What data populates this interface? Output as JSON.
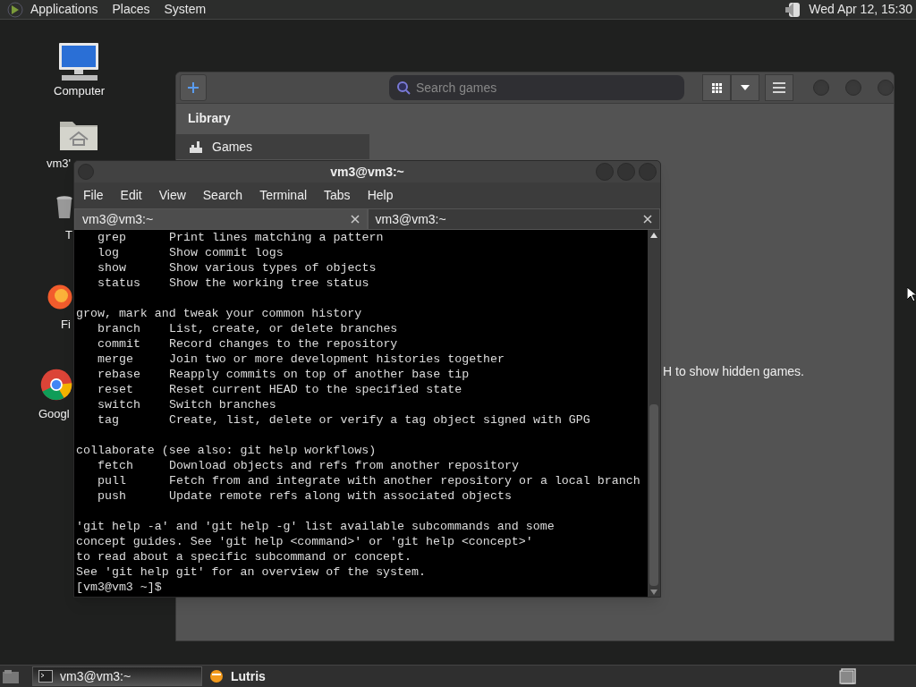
{
  "top_panel": {
    "menus": [
      "Applications",
      "Places",
      "System"
    ],
    "clock": "Wed Apr 12, 15:30"
  },
  "desktop_icons": [
    {
      "kind": "computer",
      "label": "Computer"
    },
    {
      "kind": "home",
      "label": "vm3'"
    },
    {
      "kind": "trash",
      "label": "T"
    },
    {
      "kind": "firefox",
      "label": "Fi"
    },
    {
      "kind": "chrome",
      "label": "Googl"
    }
  ],
  "lutris": {
    "search": {
      "placeholder": "Search games"
    },
    "sidebar": {
      "heading": "Library",
      "items": [
        {
          "label": "Games",
          "selected": true
        }
      ]
    },
    "hint": "H to show hidden games."
  },
  "terminal": {
    "title": "vm3@vm3:~",
    "menus": [
      "File",
      "Edit",
      "View",
      "Search",
      "Terminal",
      "Tabs",
      "Help"
    ],
    "tabs": [
      {
        "label": "vm3@vm3:~",
        "selected": false
      },
      {
        "label": "vm3@vm3:~",
        "selected": true
      }
    ],
    "blocks": [
      {
        "rows": [
          {
            "command": "grep",
            "description": "Print lines matching a pattern"
          },
          {
            "command": "log",
            "description": "Show commit logs"
          },
          {
            "command": "show",
            "description": "Show various types of objects"
          },
          {
            "command": "status",
            "description": "Show the working tree status"
          }
        ]
      },
      {
        "heading": "grow, mark and tweak your common history",
        "rows": [
          {
            "command": "branch",
            "description": "List, create, or delete branches"
          },
          {
            "command": "commit",
            "description": "Record changes to the repository"
          },
          {
            "command": "merge",
            "description": "Join two or more development histories together"
          },
          {
            "command": "rebase",
            "description": "Reapply commits on top of another base tip"
          },
          {
            "command": "reset",
            "description": "Reset current HEAD to the specified state"
          },
          {
            "command": "switch",
            "description": "Switch branches"
          },
          {
            "command": "tag",
            "description": "Create, list, delete or verify a tag object signed with GPG"
          }
        ]
      },
      {
        "heading": "collaborate (see also: git help workflows)",
        "rows": [
          {
            "command": "fetch",
            "description": "Download objects and refs from another repository"
          },
          {
            "command": "pull",
            "description": "Fetch from and integrate with another repository or a local branch"
          },
          {
            "command": "push",
            "description": "Update remote refs along with associated objects"
          }
        ]
      },
      {
        "lines": [
          "'git help -a' and 'git help -g' list available subcommands and some",
          "concept guides. See 'git help <command>' or 'git help <concept>'",
          "to read about a specific subcommand or concept.",
          "See 'git help git' for an overview of the system."
        ]
      }
    ],
    "prompt": "[vm3@vm3 ~]$"
  },
  "taskbar": {
    "tasks": [
      {
        "label": "vm3@vm3:~",
        "kind": "terminal",
        "selected": true
      },
      {
        "label": "Lutris",
        "kind": "lutris",
        "selected": false
      }
    ]
  }
}
